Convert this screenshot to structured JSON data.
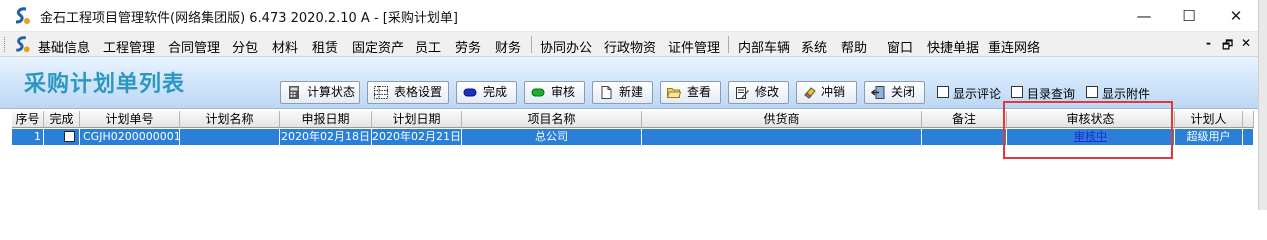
{
  "window": {
    "title": "金石工程项目管理软件(网络集团版) 6.473  2020.2.10 A - [采购计划单]",
    "minimize": "—",
    "maximize": "☐",
    "close": "✕"
  },
  "menubar": {
    "items": [
      "基础信息",
      "工程管理",
      "合同管理",
      "分包",
      "材料",
      "租赁",
      "固定资产",
      "员工",
      "劳务",
      "财务",
      "协同办公",
      "行政物资",
      "证件管理",
      "内部车辆",
      "系统",
      "帮助",
      "窗口",
      "快捷单据",
      "重连网络"
    ],
    "mdi": {
      "minimize": "-",
      "restore": "🗗",
      "close": "✕"
    }
  },
  "header": {
    "title": "采购计划单列表",
    "buttons": {
      "calc_status": "计算状态",
      "table_settings": "表格设置",
      "complete": "完成",
      "audit": "审核",
      "new": "新建",
      "view": "查看",
      "edit": "修改",
      "reverse": "冲销",
      "close": "关闭"
    },
    "checkboxes": {
      "show_comments": "显示评论",
      "directory_query": "目录查询",
      "show_attachments": "显示附件"
    }
  },
  "grid": {
    "columns": [
      "序号",
      "完成",
      "计划单号",
      "计划名称",
      "申报日期",
      "计划日期",
      "项目名称",
      "供货商",
      "备注",
      "审核状态",
      "计划人",
      ""
    ],
    "rows": [
      {
        "index": "1",
        "complete": false,
        "plan_no": "CGJH0200000001",
        "plan_name": "",
        "declare_date": "2020年02月18日",
        "plan_date": "2020年02月21日",
        "project": "总公司",
        "supplier": "",
        "remark": "",
        "audit_status": "审核中",
        "planner": "超级用户"
      }
    ]
  },
  "colors": {
    "title_accent": "#2d97c2",
    "selected_row": "#2a7fd6",
    "annotation_box": "#e23a3a",
    "link": "#1a2bd6"
  }
}
